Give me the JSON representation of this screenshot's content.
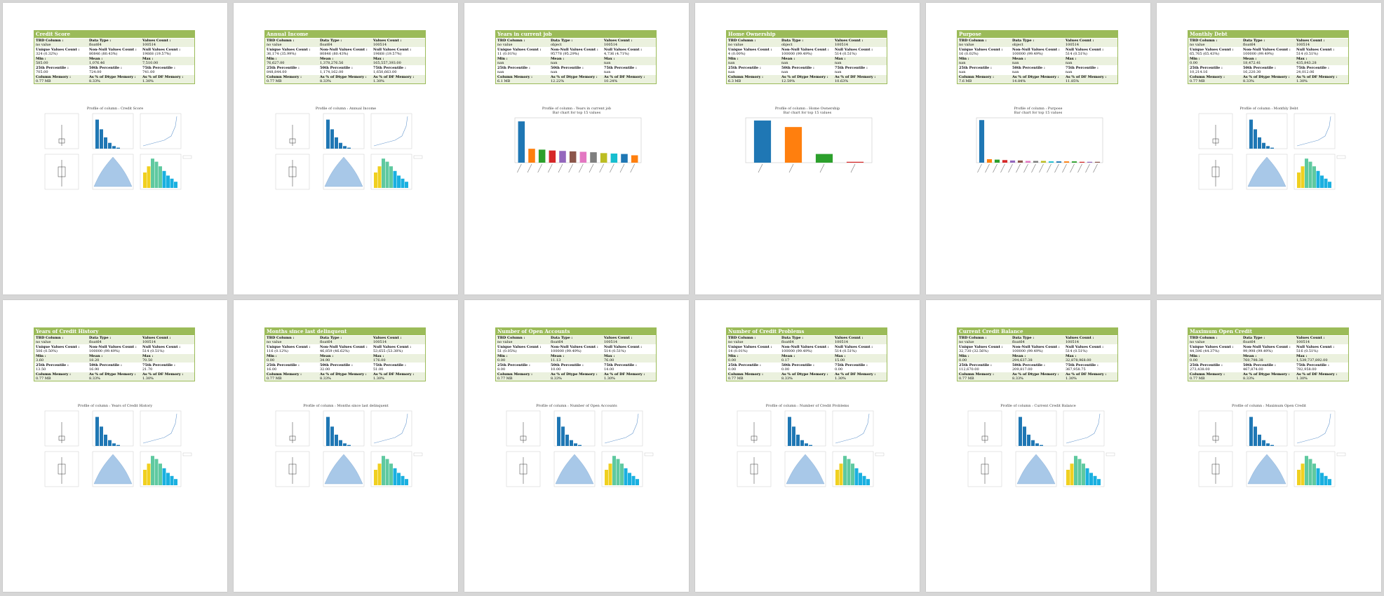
{
  "pages": [
    {
      "title": "Credit Score",
      "profile_title": "Profile of column : Credit Score",
      "kind": "numeric",
      "labels": {
        "th": "TBD Column :",
        "dtype": "Data Type :",
        "count": "Values Count :",
        "uniq": "Unique Values Count :",
        "nonnull": "Non-Null Values Count :",
        "null": "Null Values Count :",
        "min": "Min :",
        "mean": "Mean :",
        "max": "Max :",
        "p25": "25th Percentile :",
        "p50": "50th Percentile :",
        "p75": "75th Percentile :",
        "mem": "Column Memory :",
        "dtmem": "As % of Dtype Memory :",
        "dfmem": "As % of DF Memory :"
      },
      "v": {
        "th": "no value",
        "dtype": "float64",
        "count": "100514",
        "uniq": "324 (0.32%)",
        "nonnull": "80846 (80.43%)",
        "null": "19668 (19.57%)",
        "min": "585.00",
        "mean": "1,076.46",
        "max": "7,510.00",
        "p25": "705.00",
        "p50": "724.00",
        "p75": "741.00",
        "mem": "0.77 MB",
        "dtmem": "8.33%",
        "dfmem": "1.30%"
      }
    },
    {
      "title": "Annual Income",
      "profile_title": "Profile of column : Annual Income",
      "kind": "numeric",
      "v": {
        "th": "no value",
        "dtype": "float64",
        "count": "100514",
        "uniq": "36,174 (35.99%)",
        "nonnull": "80846 (80.43%)",
        "null": "19668 (19.57%)",
        "min": "76,627.00",
        "mean": "1,378,276.56",
        "max": "165,557,393.00",
        "p25": "848,844.00",
        "p50": "1,174,162.00",
        "p75": "1,650,663.00",
        "mem": "0.77 MB",
        "dtmem": "8.33%",
        "dfmem": "1.30%"
      }
    },
    {
      "title": "Years in current job",
      "profile_title": "Profile of column : Years in current job",
      "sub": "Bar chart for top 15 values",
      "kind": "bar",
      "bars": [
        0.95,
        0.32,
        0.3,
        0.28,
        0.27,
        0.26,
        0.25,
        0.24,
        0.22,
        0.21,
        0.2,
        0.17
      ],
      "v": {
        "th": "no value",
        "dtype": "object",
        "count": "100514",
        "uniq": "11 (0.01%)",
        "nonnull": "95778 (95.29%)",
        "null": "4,736 (4.71%)",
        "min": "nan",
        "mean": "nan",
        "max": "nan",
        "p25": "nan",
        "p50": "nan",
        "p75": "nan",
        "mem": "6.1 MB",
        "dtmem": "12.22%",
        "dfmem": "10.24%"
      }
    },
    {
      "title": "Home Ownership",
      "profile_title": "Profile of column : Home Ownership",
      "sub": "Bar chart for top 15 values",
      "kind": "bar4",
      "bars": [
        0.97,
        0.82,
        0.2,
        0.02
      ],
      "v": {
        "th": "no value",
        "dtype": "object",
        "count": "100514",
        "uniq": "4 (0.00%)",
        "nonnull": "100000 (99.49%)",
        "null": "514 (0.51%)",
        "min": "nan",
        "mean": "nan",
        "max": "nan",
        "p25": "nan",
        "p50": "nan",
        "p75": "nan",
        "mem": "6.3 MB",
        "dtmem": "12.59%",
        "dfmem": "10.63%"
      }
    },
    {
      "title": "Purpose",
      "profile_title": "Profile of column : Purpose",
      "sub": "Bar chart for top 15 values",
      "kind": "barmany",
      "bars": [
        0.98,
        0.08,
        0.07,
        0.06,
        0.05,
        0.05,
        0.04,
        0.04,
        0.04,
        0.03,
        0.03,
        0.03,
        0.03,
        0.02,
        0.02,
        0.02
      ],
      "v": {
        "th": "no value",
        "dtype": "object",
        "count": "100514",
        "uniq": "16 (0.02%)",
        "nonnull": "100000 (99.49%)",
        "null": "514 (0.51%)",
        "min": "nan",
        "mean": "nan",
        "max": "nan",
        "p25": "nan",
        "p50": "nan",
        "p75": "nan",
        "mem": "7.6 MB",
        "dtmem": "14.84%",
        "dfmem": "11.85%"
      }
    },
    {
      "title": "Monthly Debt",
      "profile_title": "Profile of column : Monthly Debt",
      "kind": "numeric",
      "v": {
        "th": "no value",
        "dtype": "float64",
        "count": "100514",
        "uniq": "65,765 (65.43%)",
        "nonnull": "100000 (99.49%)",
        "null": "514 (0.51%)",
        "min": "0.00",
        "mean": "18,472.41",
        "max": "435,843.28",
        "p25": "10,214.16",
        "p50": "16,220.30",
        "p75": "24,012.06",
        "mem": "0.77 MB",
        "dtmem": "8.33%",
        "dfmem": "1.30%"
      }
    },
    {
      "title": "Years of Credit History",
      "profile_title": "Profile of column : Years of Credit History",
      "kind": "numeric",
      "v": {
        "th": "no value",
        "dtype": "float64",
        "count": "100514",
        "uniq": "506 (0.50%)",
        "nonnull": "100000 (99.49%)",
        "null": "514 (0.51%)",
        "min": "3.60",
        "mean": "18.20",
        "max": "70.50",
        "p25": "13.50",
        "p50": "16.90",
        "p75": "21.70",
        "mem": "0.77 MB",
        "dtmem": "8.33%",
        "dfmem": "1.30%"
      }
    },
    {
      "title": "Months since last delinquent",
      "profile_title": "Profile of column : Months since last delinquent",
      "kind": "numeric",
      "v": {
        "th": "no value",
        "dtype": "float64",
        "count": "100514",
        "uniq": "116 (0.12%)",
        "nonnull": "46,859 (46.62%)",
        "null": "53,655 (53.38%)",
        "min": "0.00",
        "mean": "34.90",
        "max": "176.00",
        "p25": "16.00",
        "p50": "32.00",
        "p75": "51.00",
        "mem": "0.77 MB",
        "dtmem": "8.33%",
        "dfmem": "1.30%"
      }
    },
    {
      "title": "Number of Open Accounts",
      "profile_title": "Profile of column : Number of Open Accounts",
      "kind": "numeric",
      "v": {
        "th": "no value",
        "dtype": "float64",
        "count": "100514",
        "uniq": "51 (0.05%)",
        "nonnull": "100000 (99.49%)",
        "null": "514 (0.51%)",
        "min": "0.00",
        "mean": "11.13",
        "max": "76.00",
        "p25": "8.00",
        "p50": "10.00",
        "p75": "14.00",
        "mem": "0.77 MB",
        "dtmem": "8.33%",
        "dfmem": "1.30%"
      }
    },
    {
      "title": "Number of Credit Problems",
      "profile_title": "Profile of column : Number of Credit Problems",
      "kind": "numeric",
      "v": {
        "th": "no value",
        "dtype": "float64",
        "count": "100514",
        "uniq": "14 (0.01%)",
        "nonnull": "100000 (99.49%)",
        "null": "514 (0.51%)",
        "min": "0.00",
        "mean": "0.17",
        "max": "15.00",
        "p25": "0.00",
        "p50": "0.00",
        "p75": "0.00",
        "mem": "0.77 MB",
        "dtmem": "8.33%",
        "dfmem": "1.30%"
      }
    },
    {
      "title": "Current Credit Balance",
      "profile_title": "Profile of column : Current Credit Balance",
      "kind": "numeric",
      "v": {
        "th": "no value",
        "dtype": "float64",
        "count": "100514",
        "uniq": "32,730 (32.56%)",
        "nonnull": "100000 (99.49%)",
        "null": "514 (0.51%)",
        "min": "0.00",
        "mean": "294,637.38",
        "max": "32,878,968.00",
        "p25": "112,670.00",
        "p50": "209,817.00",
        "p75": "367,958.75",
        "mem": "0.77 MB",
        "dtmem": "8.33%",
        "dfmem": "1.30%"
      }
    },
    {
      "title": "Maximum Open Credit",
      "profile_title": "Profile of column : Maximum Open Credit",
      "kind": "numeric",
      "v": {
        "th": "no value",
        "dtype": "float64",
        "count": "100514",
        "uniq": "44,596 (44.37%)",
        "nonnull": "99,998 (99.49%)",
        "null": "516 (0.51%)",
        "min": "0.00",
        "mean": "760,798.38",
        "max": "1,539,737,892.00",
        "p25": "273,438.00",
        "p50": "467,874.00",
        "p75": "782,958.00",
        "mem": "0.77 MB",
        "dtmem": "8.33%",
        "dfmem": "1.30%"
      }
    }
  ],
  "colors": {
    "header": "#9bbb59",
    "row": "#ebf1de",
    "blue": "#1f77b4",
    "orange": "#ff7f0e",
    "green": "#2ca02c",
    "violin": "#a8c8e8",
    "teal": "#5fc9a0",
    "yellow": "#f0d020",
    "cyan": "#1ab0e0"
  },
  "bar_palette": [
    "#1f77b4",
    "#ff7f0e",
    "#2ca02c",
    "#d62728",
    "#9467bd",
    "#8c564b",
    "#e377c2",
    "#7f7f7f",
    "#bcbd22",
    "#17becf",
    "#1f77b4",
    "#ff7f0e",
    "#2ca02c",
    "#d62728",
    "#9467bd",
    "#8c564b"
  ]
}
